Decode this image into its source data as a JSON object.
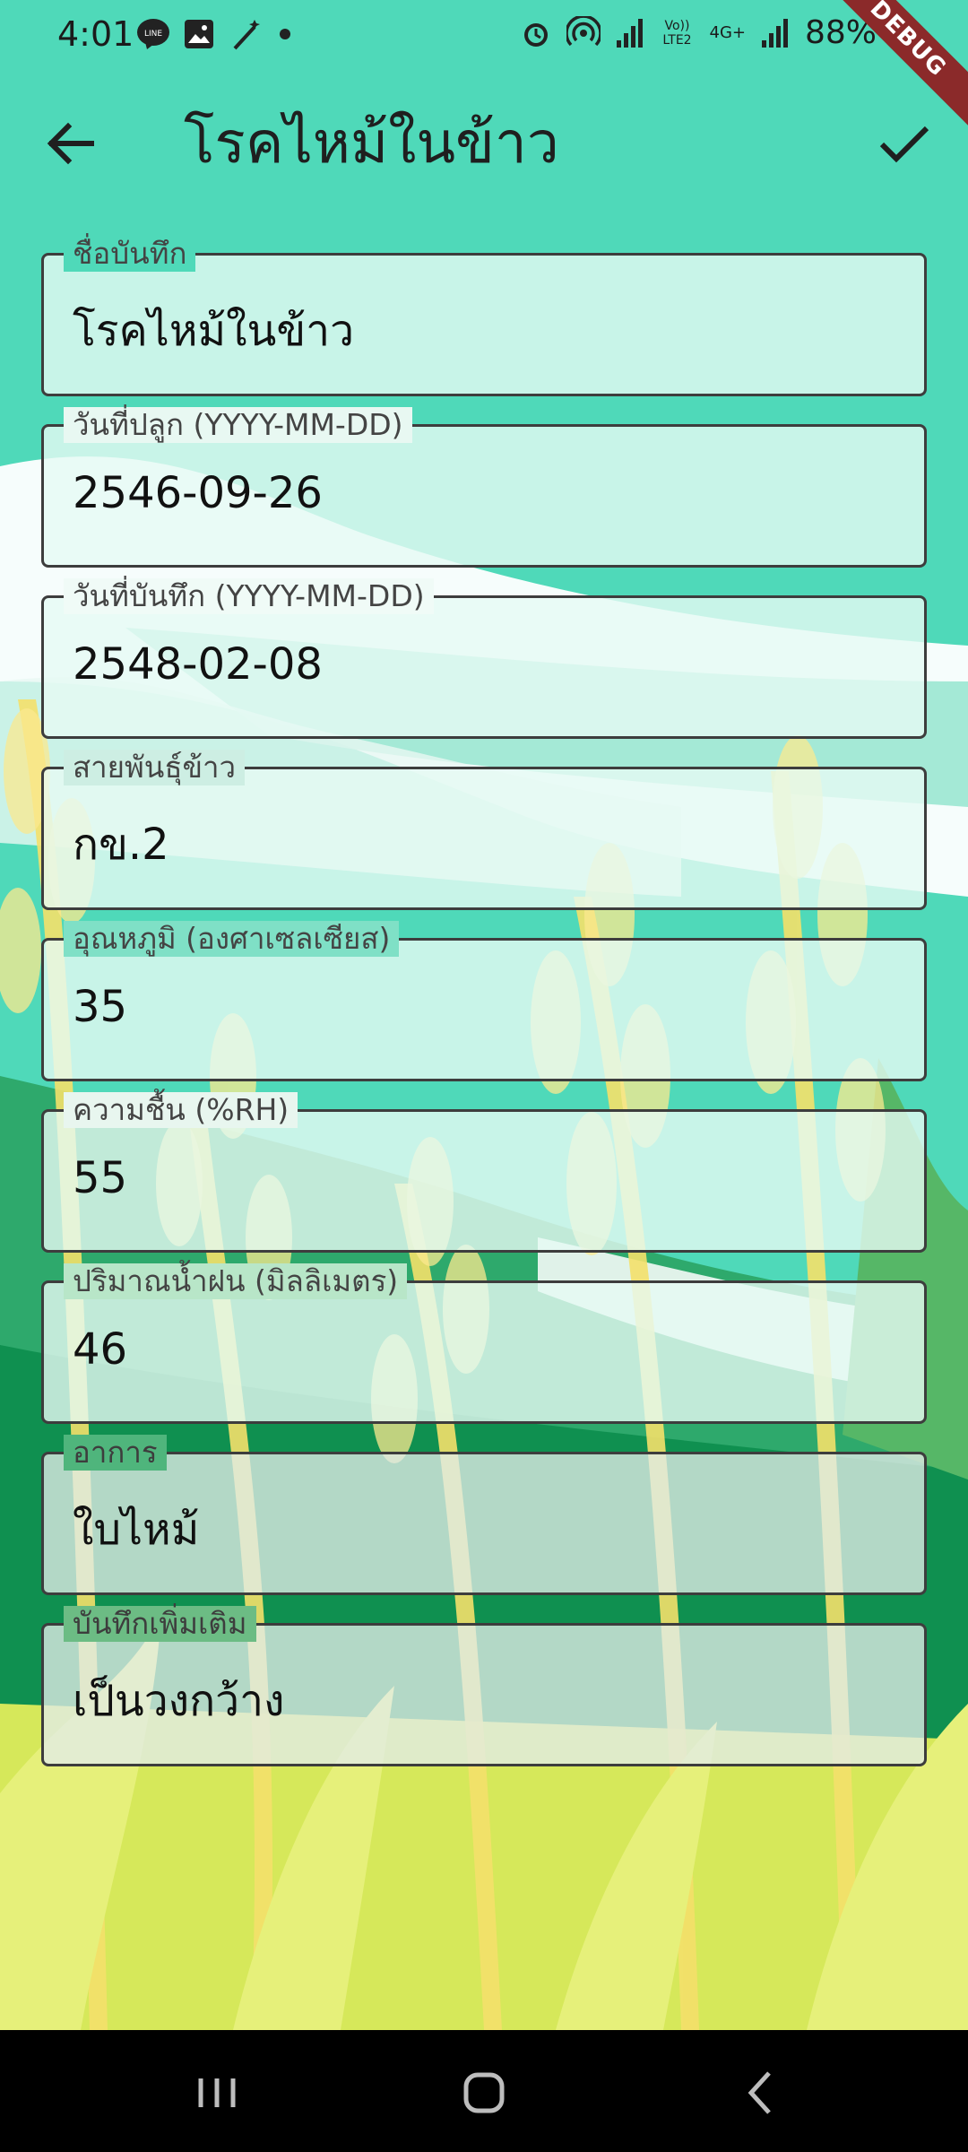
{
  "status_bar": {
    "time": "4:01",
    "battery": "88%",
    "net_label": "Vo)) LTE2",
    "net_type": "4G+",
    "left_icons": [
      "line-icon",
      "image-icon",
      "magic-wand-icon",
      "dot-icon"
    ],
    "right_icons": [
      "alarm-icon",
      "hotspot-icon",
      "signal-icon",
      "signal-icon-2",
      "battery-icon"
    ]
  },
  "debug_banner": "DEBUG",
  "app_bar": {
    "title": "โรคไหม้ในข้าว",
    "back_icon": "arrow-left-icon",
    "save_icon": "check-icon"
  },
  "fields": [
    {
      "label": "ชื่อบันทึก",
      "value": "โรคไหม้ในข้าว"
    },
    {
      "label": "วันที่ปลูก (YYYY-MM-DD)",
      "value": "2546-09-26"
    },
    {
      "label": "วันที่บันทึก (YYYY-MM-DD)",
      "value": "2548-02-08"
    },
    {
      "label": "สายพันธุ์ข้าว",
      "value": "กข.2"
    },
    {
      "label": "อุณหภูมิ (องศาเซลเซียส)",
      "value": "35"
    },
    {
      "label": "ความชื้น (%RH)",
      "value": "55"
    },
    {
      "label": "ปริมาณน้ำฝน (มิลลิเมตร)",
      "value": "46"
    },
    {
      "label": "อาการ",
      "value": "ใบไหม้"
    },
    {
      "label": "บันทึกเพิ่มเติม",
      "value": "เป็นวงกว้าง"
    }
  ],
  "nav_bar": {
    "icons": [
      "recent-apps-icon",
      "home-icon",
      "back-icon"
    ]
  },
  "colors": {
    "sky": "#4fd9b9",
    "grass_dark": "#0f9050",
    "grass_light": "#e2ee70",
    "wheat": "#fde88a"
  }
}
